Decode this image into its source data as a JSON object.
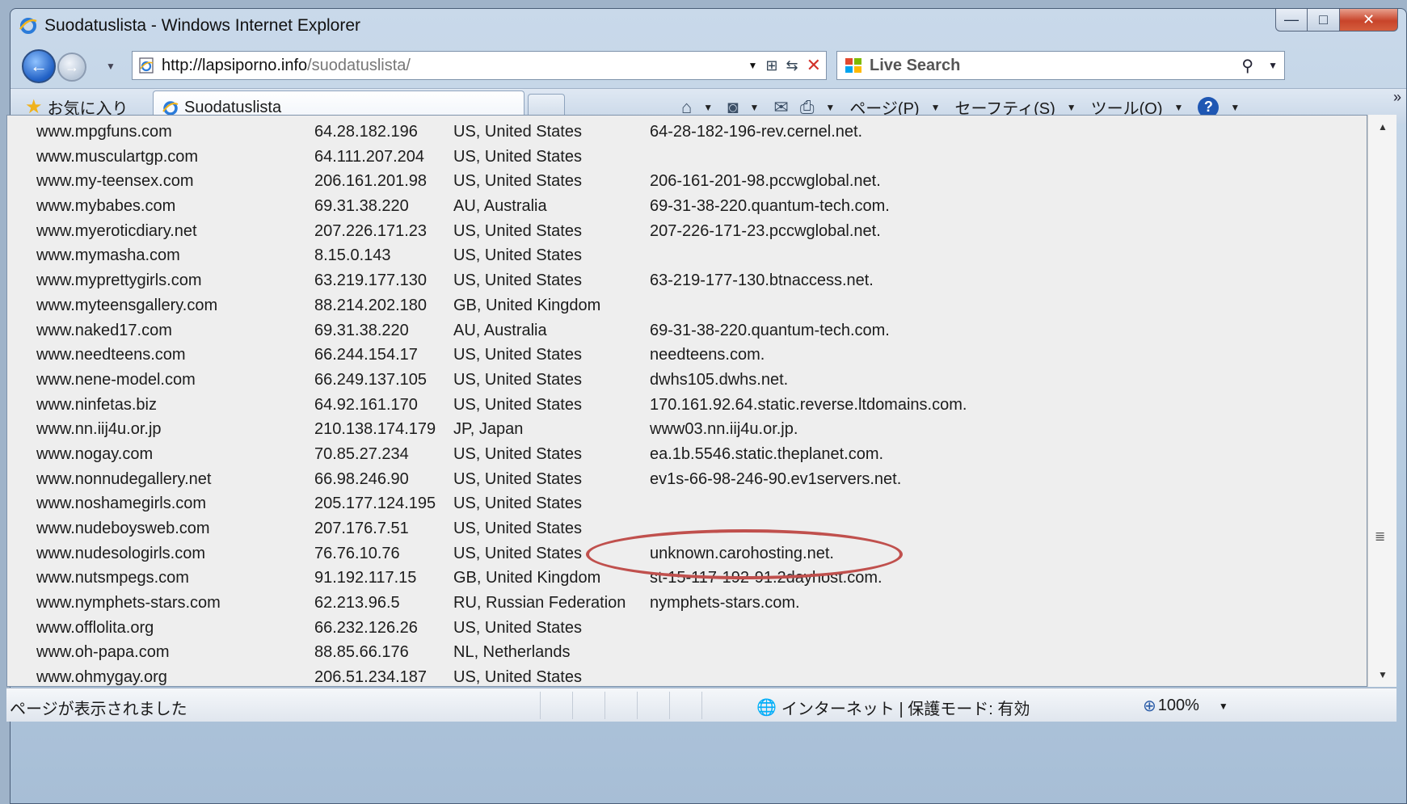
{
  "window": {
    "title": "Suodatuslista - Windows Internet Explorer",
    "minimize_glyph": "—",
    "maximize_glyph": "□",
    "close_glyph": "✕"
  },
  "navbar": {
    "url_domain": "http://lapsiporno.info",
    "url_path": "/suodatuslista/",
    "search_placeholder": "Live Search",
    "icons": [
      "back-icon",
      "forward-icon",
      "page-icon",
      "rss-icon",
      "refresh-icon",
      "stop-icon",
      "search-icon"
    ]
  },
  "commandbar": {
    "favorites_label": "お気に入り",
    "tab_label": "Suodatuslista",
    "page_menu": "ページ(P)",
    "safety_menu": "セーフティ(S)",
    "tools_menu": "ツール(O)",
    "help_glyph": "?"
  },
  "rows": [
    {
      "domain": "www.mpgfuns.com",
      "ip": "64.28.182.196",
      "country": "US, United States",
      "host": "64-28-182-196-rev.cernel.net."
    },
    {
      "domain": "www.musculartgp.com",
      "ip": "64.111.207.204",
      "country": "US, United States",
      "host": ""
    },
    {
      "domain": "www.my-teensex.com",
      "ip": "206.161.201.98",
      "country": "US, United States",
      "host": "206-161-201-98.pccwglobal.net."
    },
    {
      "domain": "www.mybabes.com",
      "ip": "69.31.38.220",
      "country": "AU, Australia",
      "host": "69-31-38-220.quantum-tech.com."
    },
    {
      "domain": "www.myeroticdiary.net",
      "ip": "207.226.171.23",
      "country": "US, United States",
      "host": "207-226-171-23.pccwglobal.net."
    },
    {
      "domain": "www.mymasha.com",
      "ip": "8.15.0.143",
      "country": "US, United States",
      "host": ""
    },
    {
      "domain": "www.myprettygirls.com",
      "ip": "63.219.177.130",
      "country": "US, United States",
      "host": "63-219-177-130.btnaccess.net."
    },
    {
      "domain": "www.myteensgallery.com",
      "ip": "88.214.202.180",
      "country": "GB, United Kingdom",
      "host": ""
    },
    {
      "domain": "www.naked17.com",
      "ip": "69.31.38.220",
      "country": "AU, Australia",
      "host": "69-31-38-220.quantum-tech.com."
    },
    {
      "domain": "www.needteens.com",
      "ip": "66.244.154.17",
      "country": "US, United States",
      "host": "needteens.com."
    },
    {
      "domain": "www.nene-model.com",
      "ip": "66.249.137.105",
      "country": "US, United States",
      "host": "dwhs105.dwhs.net."
    },
    {
      "domain": "www.ninfetas.biz",
      "ip": "64.92.161.170",
      "country": "US, United States",
      "host": "170.161.92.64.static.reverse.ltdomains.com."
    },
    {
      "domain": "www.nn.iij4u.or.jp",
      "ip": "210.138.174.179",
      "country": "JP, Japan",
      "host": "www03.nn.iij4u.or.jp."
    },
    {
      "domain": "www.nogay.com",
      "ip": "70.85.27.234",
      "country": "US, United States",
      "host": "ea.1b.5546.static.theplanet.com."
    },
    {
      "domain": "www.nonnudegallery.net",
      "ip": "66.98.246.90",
      "country": "US, United States",
      "host": "ev1s-66-98-246-90.ev1servers.net."
    },
    {
      "domain": "www.noshamegirls.com",
      "ip": "205.177.124.195",
      "country": "US, United States",
      "host": ""
    },
    {
      "domain": "www.nudeboysweb.com",
      "ip": "207.176.7.51",
      "country": "US, United States",
      "host": ""
    },
    {
      "domain": "www.nudesologirls.com",
      "ip": "76.76.10.76",
      "country": "US, United States",
      "host": "unknown.carohosting.net."
    },
    {
      "domain": "www.nutsmpegs.com",
      "ip": "91.192.117.15",
      "country": "GB, United Kingdom",
      "host": "st-15-117-192-91.2dayhost.com."
    },
    {
      "domain": "www.nymphets-stars.com",
      "ip": "62.213.96.5",
      "country": "RU, Russian Federation",
      "host": "nymphets-stars.com."
    },
    {
      "domain": "www.offlolita.org",
      "ip": "66.232.126.26",
      "country": "US, United States",
      "host": ""
    },
    {
      "domain": "www.oh-papa.com",
      "ip": "88.85.66.176",
      "country": "NL, Netherlands",
      "host": ""
    },
    {
      "domain": "www.ohmygay.org",
      "ip": "206.51.234.187",
      "country": "US, United States",
      "host": ""
    }
  ],
  "status": {
    "text": "ページが表示されました",
    "zone": "インターネット | 保護モード: 有効",
    "zoom": "100%"
  },
  "colors": {
    "highlight_oval": "#c0504d",
    "page_background": "#eeeeee"
  }
}
